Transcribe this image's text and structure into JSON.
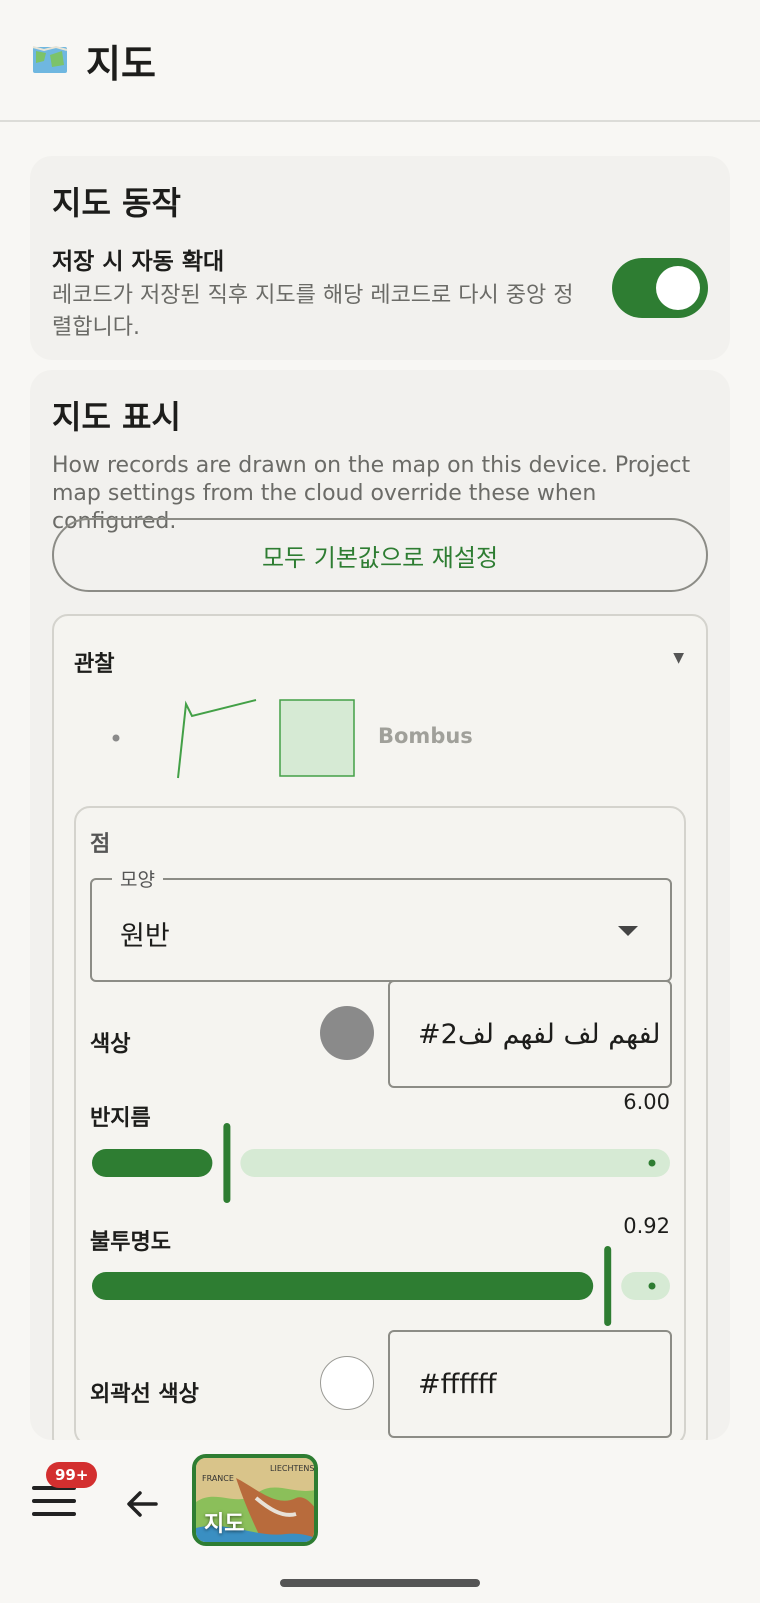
{
  "header": {
    "title": "지도",
    "icon": "map-icon"
  },
  "behavior": {
    "title": "지도 동작",
    "auto_zoom_title": "저장 시 자동 확대",
    "auto_zoom_desc": "레코드가 저장된 직후 지도를 해당 레코드로 다시 중앙 정렬합니다.",
    "auto_zoom_enabled": true
  },
  "display": {
    "title": "지도 표시",
    "desc": "How records are drawn on the map on this device. Project map settings from the cloud override these when configured.",
    "reset_label": "모두 기본값으로 재설정",
    "observation": {
      "label": "관찰",
      "preview_name": "Bombus",
      "point": {
        "label": "점",
        "shape_legend": "모양",
        "shape_value": "원반",
        "color_label": "색상",
        "color_value": "#2لفهم لف لفهم لف",
        "color_swatch": "#8a8a8a",
        "radius_label": "반지름",
        "radius_value": "6.00",
        "radius_fraction": 0.24,
        "opacity_label": "불투명도",
        "opacity_value": "0.92",
        "opacity_fraction": 0.92,
        "stroke_color_label": "외곽선 색상",
        "stroke_color_value": "#ffffff",
        "stroke_swatch": "#ffffff"
      }
    }
  },
  "bottom_nav": {
    "badge": "99+",
    "map_label": "지도",
    "map_tag_1": "FRANCE",
    "map_tag_2": "LIECHTENS"
  },
  "colors": {
    "accent": "#2e7d32",
    "accent_light": "#d6ead4"
  }
}
